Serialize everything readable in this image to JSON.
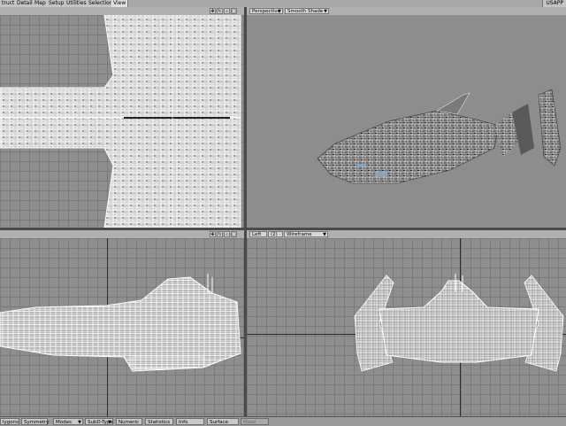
{
  "menu": {
    "tabs": [
      "truct",
      "Detail",
      "Map",
      "Setup",
      "Utilities",
      "Selection",
      "View"
    ],
    "app_title": "USAPP"
  },
  "viewports": {
    "top": {
      "icons": [
        "move-icon",
        "rotate-icon",
        "zoom-icon",
        "maximize-icon"
      ]
    },
    "perspective": {
      "projection": "Perspective",
      "shading": "Smooth Shade"
    },
    "front": {
      "icons": [
        "move-icon",
        "rotate-icon",
        "zoom-icon",
        "maximize-icon"
      ]
    },
    "left": {
      "projection": "Left",
      "camera": "(2) ·",
      "shading": "Wireframe"
    }
  },
  "bottombar": {
    "buttons": [
      {
        "label": "lygons",
        "dropdown": false
      },
      {
        "label": "Symmetry",
        "dropdown": false
      },
      {
        "label": "Modes",
        "dropdown": true
      },
      {
        "label": "SubD-Type",
        "dropdown": true
      },
      {
        "label": "Numeric",
        "dropdown": false
      },
      {
        "label": "Statistics",
        "dropdown": false
      },
      {
        "label": "Info",
        "dropdown": false
      },
      {
        "label": "Surface",
        "dropdown": false
      },
      {
        "label": "Make",
        "dropdown": false
      }
    ]
  },
  "colors": {
    "viewport_bg": "#8e8e8e",
    "grid_line": "#7a7a7a",
    "wireframe": "#ffffff",
    "ship_shaded": "#5a5a5a",
    "panel": "#b0b0b0"
  }
}
